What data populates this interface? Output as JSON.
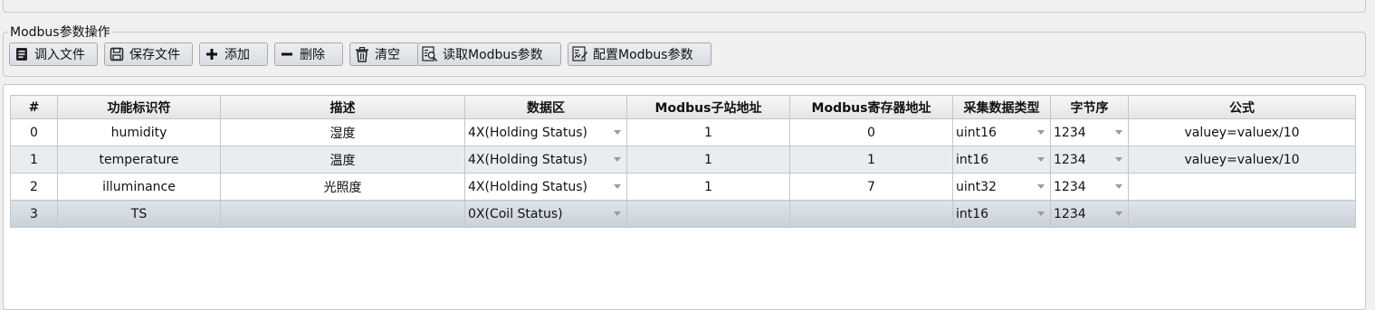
{
  "group": {
    "title": "Modbus参数操作"
  },
  "toolbar": {
    "buttons": [
      {
        "label": "调入文件",
        "icon": "file-import-icon"
      },
      {
        "label": "保存文件",
        "icon": "save-icon"
      },
      {
        "label": "添加",
        "icon": "plus-icon"
      },
      {
        "label": "删除",
        "icon": "minus-icon"
      },
      {
        "label": "清空",
        "icon": "trash-icon"
      },
      {
        "label": "读取Modbus参数",
        "icon": "read-params-icon"
      },
      {
        "label": "配置Modbus参数",
        "icon": "configure-params-icon"
      }
    ]
  },
  "table": {
    "headers": [
      "#",
      "功能标识符",
      "描述",
      "数据区",
      "Modbus子站地址",
      "Modbus寄存器地址",
      "采集数据类型",
      "字节序",
      "公式"
    ],
    "rows": [
      {
        "idx": "0",
        "id": "humidity",
        "desc": "湿度",
        "area": "4X(Holding Status)",
        "slave": "1",
        "reg": "0",
        "dtype": "uint16",
        "order": "1234",
        "formula": "valuey=valuex/10"
      },
      {
        "idx": "1",
        "id": "temperature",
        "desc": "温度",
        "area": "4X(Holding Status)",
        "slave": "1",
        "reg": "1",
        "dtype": "int16",
        "order": "1234",
        "formula": "valuey=valuex/10"
      },
      {
        "idx": "2",
        "id": "illuminance",
        "desc": "光照度",
        "area": "4X(Holding Status)",
        "slave": "1",
        "reg": "7",
        "dtype": "uint32",
        "order": "1234",
        "formula": ""
      },
      {
        "idx": "3",
        "id": "TS",
        "desc": "",
        "area": "0X(Coil Status)",
        "slave": "",
        "reg": "",
        "dtype": "int16",
        "order": "1234",
        "formula": ""
      }
    ]
  }
}
